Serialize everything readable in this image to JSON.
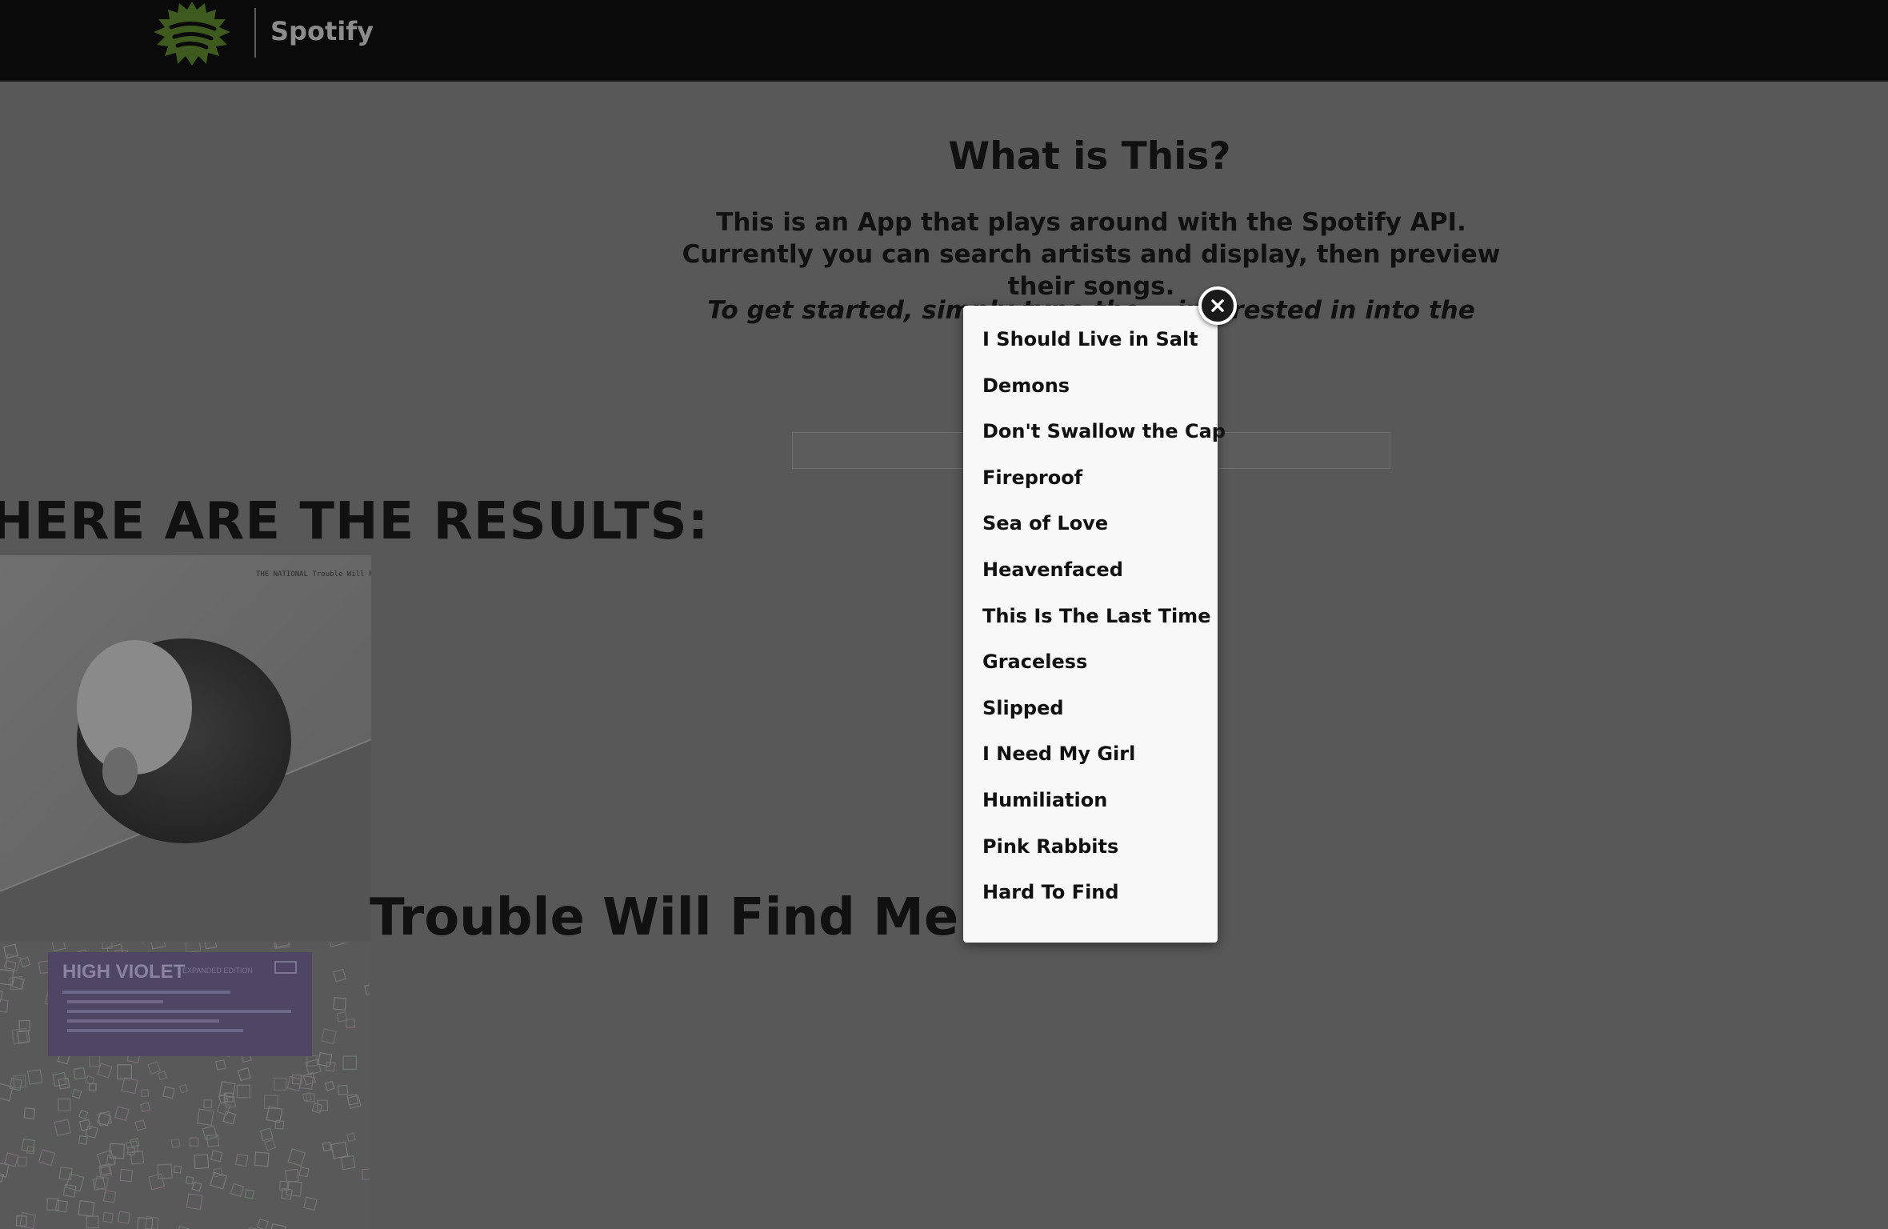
{
  "header": {
    "brand": "Spotify",
    "logo_icon": "spotify-logo-icon",
    "accent_color": "#5a7a2e"
  },
  "intro": {
    "title": "What is This?",
    "text": "This is an App that plays around with the Spotify API. Currently you can search artists and display, then preview their songs.",
    "hint_visible": "To get started, simply type the... interested in into the se... er'."
  },
  "search": {
    "value": ""
  },
  "results": {
    "heading": "HERE ARE THE RESULTS:",
    "albums": [
      {
        "title": "Trouble Will Find Me",
        "cover_text": "THE NATIONAL  Trouble Will Find Me"
      },
      {
        "cover_text": "HIGH VIOLET",
        "cover_subtitle": "EXPANDED EDITION"
      }
    ]
  },
  "modal": {
    "close_icon": "close-icon",
    "tracks": [
      "I Should Live in Salt",
      "Demons",
      "Don't Swallow the Cap",
      "Fireproof",
      "Sea of Love",
      "Heavenfaced",
      "This Is The Last Time",
      "Graceless",
      "Slipped",
      "I Need My Girl",
      "Humiliation",
      "Pink Rabbits",
      "Hard To Find"
    ]
  }
}
